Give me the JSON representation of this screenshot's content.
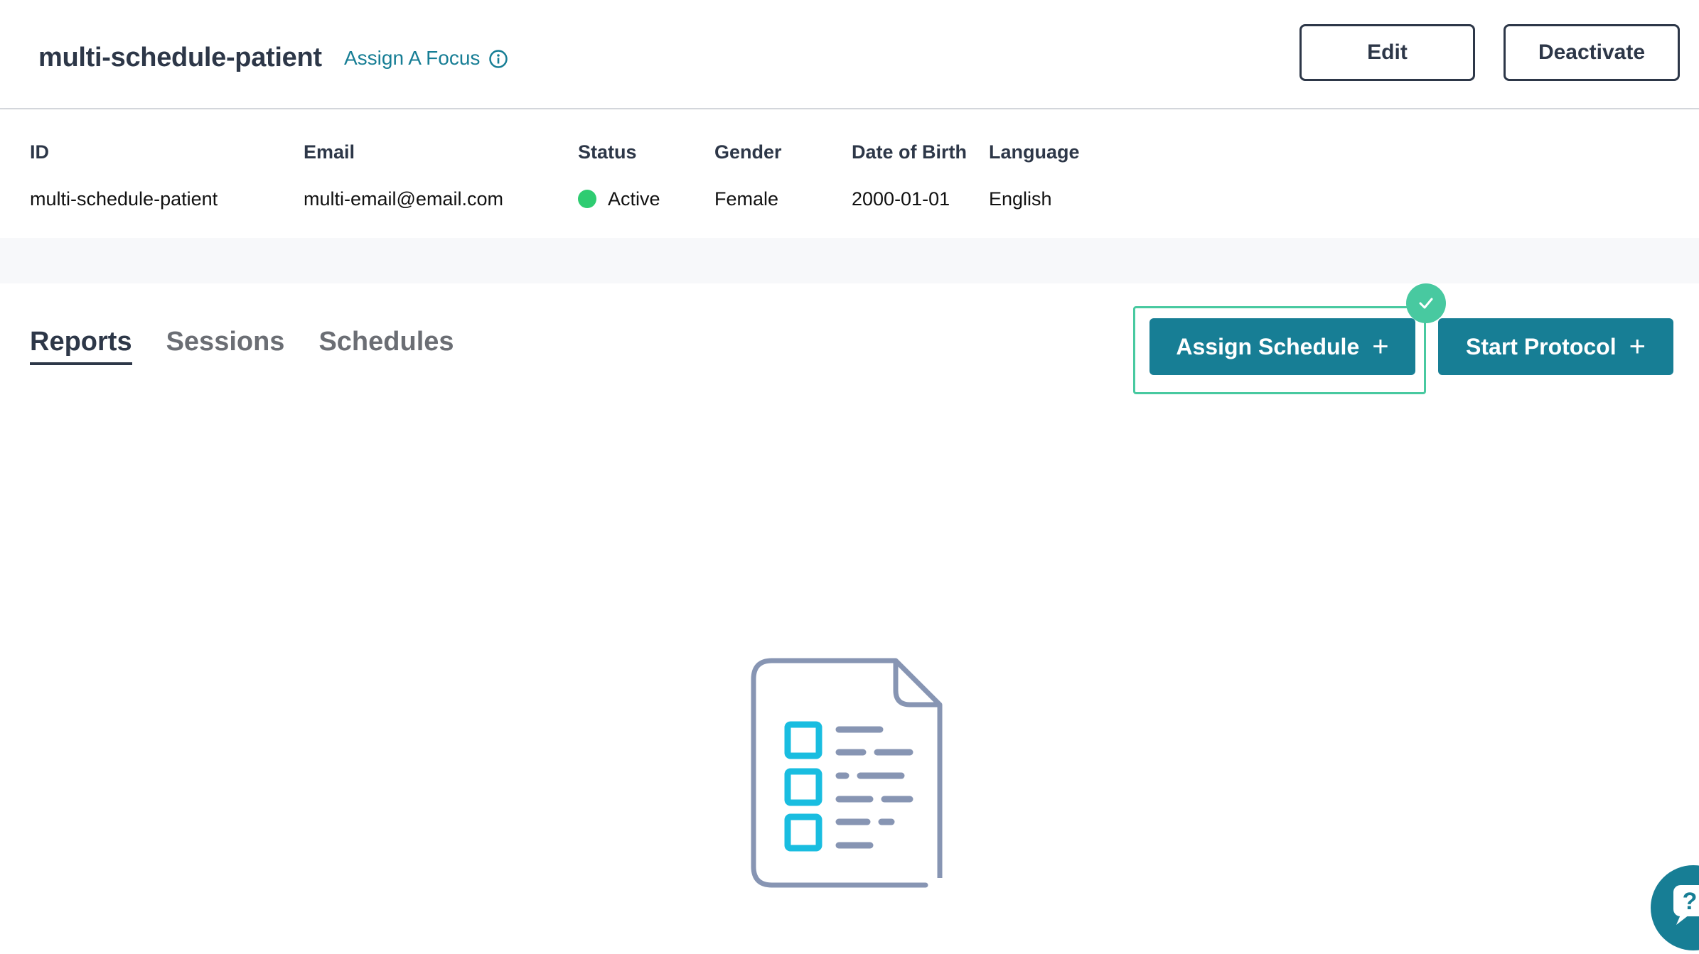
{
  "header": {
    "patient_name": "multi-schedule-patient",
    "assign_focus_label": "Assign A Focus",
    "edit_label": "Edit",
    "deactivate_label": "Deactivate"
  },
  "patient_info": {
    "columns": [
      {
        "label": "ID",
        "value": "multi-schedule-patient"
      },
      {
        "label": "Email",
        "value": "multi-email@email.com"
      },
      {
        "label": "Status",
        "value": "Active"
      },
      {
        "label": "Gender",
        "value": "Female"
      },
      {
        "label": "Date of Birth",
        "value": "2000-01-01"
      },
      {
        "label": "Language",
        "value": "English"
      }
    ],
    "status_color": "#2ecc71"
  },
  "tabs": [
    {
      "label": "Reports",
      "active": true
    },
    {
      "label": "Sessions",
      "active": false
    },
    {
      "label": "Schedules",
      "active": false
    }
  ],
  "actions": {
    "assign_schedule_label": "Assign Schedule",
    "start_protocol_label": "Start Protocol",
    "plus_symbol": "+"
  },
  "colors": {
    "primary": "#177e95",
    "highlight": "#48c9a0",
    "text_dark": "#2d3748"
  },
  "icons": {
    "info": "info-icon",
    "check": "check-icon",
    "empty_state": "report-document-icon",
    "help": "help-chat-icon"
  }
}
